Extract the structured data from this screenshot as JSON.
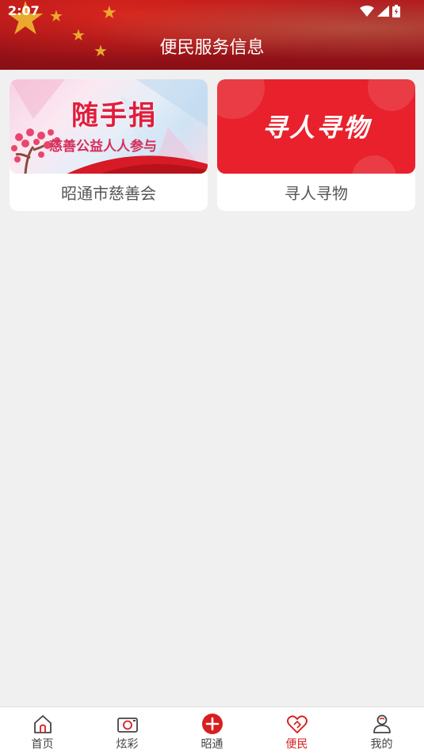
{
  "status_bar": {
    "time": "2:07",
    "icons": [
      "wifi-icon",
      "signal-icon",
      "battery-icon"
    ]
  },
  "header": {
    "title": "便民服务信息"
  },
  "cards": [
    {
      "label": "昭通市慈善会",
      "banner_title": "随手捐",
      "banner_subtitle": "慈善公益人人参与"
    },
    {
      "label": "寻人寻物",
      "banner_title": "寻人寻物"
    }
  ],
  "tabbar": {
    "items": [
      {
        "label": "首页",
        "icon": "home-icon"
      },
      {
        "label": "炫彩",
        "icon": "camera-icon"
      },
      {
        "label": "昭通",
        "icon": "plus-circle-icon"
      },
      {
        "label": "便民",
        "icon": "heart-hand-icon",
        "active": true
      },
      {
        "label": "我的",
        "icon": "user-icon"
      }
    ]
  },
  "colors": {
    "primary": "#d81e1e",
    "header_red": "#b3151b",
    "background": "#f0f0f0"
  }
}
